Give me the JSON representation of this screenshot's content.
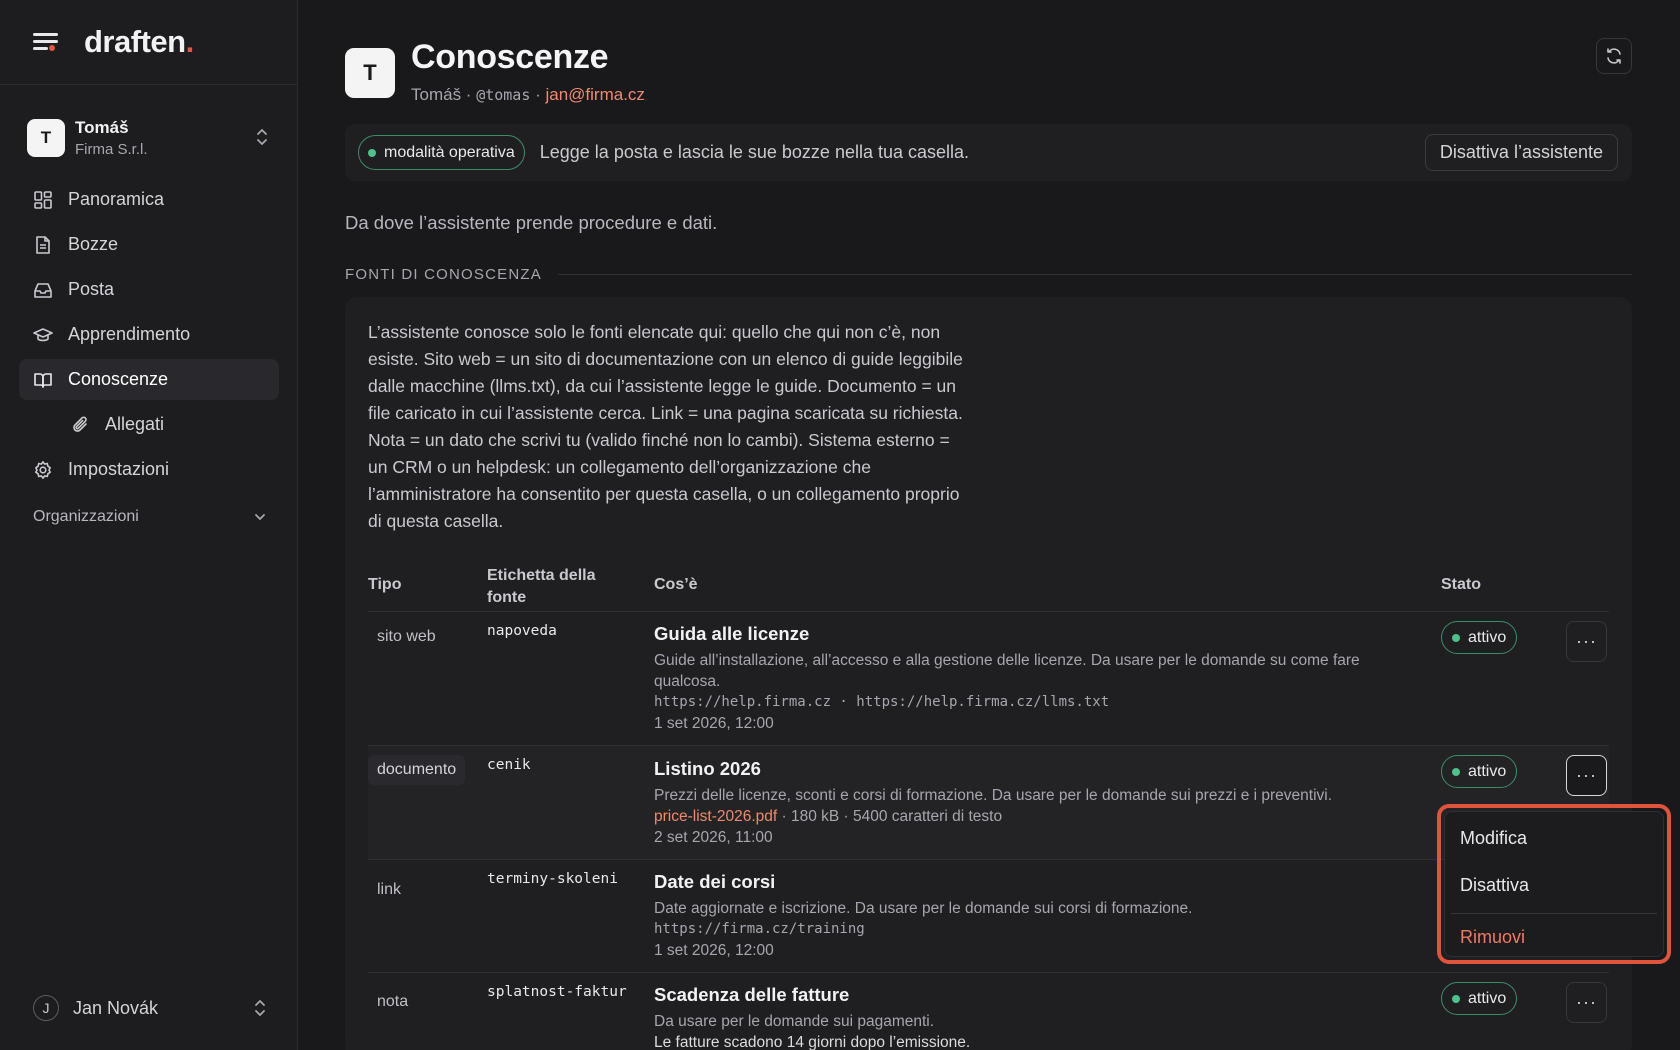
{
  "brand": {
    "name": "draften",
    "dot": "."
  },
  "workspace": {
    "avatar": "T",
    "name": "Tomáš",
    "org": "Firma S.r.l."
  },
  "nav": {
    "items": [
      {
        "label": "Panoramica",
        "icon": "dashboard-icon"
      },
      {
        "label": "Bozze",
        "icon": "document-icon"
      },
      {
        "label": "Posta",
        "icon": "inbox-icon"
      },
      {
        "label": "Apprendimento",
        "icon": "graduation-cap-icon"
      },
      {
        "label": "Conoscenze",
        "icon": "book-icon",
        "active": true
      },
      {
        "label": "Allegati",
        "icon": "paperclip-icon"
      },
      {
        "label": "Impostazioni",
        "icon": "gear-icon"
      }
    ],
    "organizations_label": "Organizzazioni"
  },
  "user": {
    "avatar": "J",
    "name": "Jan Novák"
  },
  "header": {
    "avatar": "T",
    "title": "Conoscenze",
    "name": "Tomáš",
    "separator": " · ",
    "handle": "@tomas",
    "email": "jan@firma.cz"
  },
  "status": {
    "badge": "modalità operativa",
    "text": "Legge la posta e lascia le sue bozze nella tua casella.",
    "deactivate_label": "Disattiva l’assistente",
    "badge_color": "#4cc38a"
  },
  "intro": "Da dove l’assistente prende procedure e dati.",
  "section_label": "FONTI DI CONOSCENZA",
  "card_description": "L’assistente conosce solo le fonti elencate qui: quello che qui non c’è, non esiste. Sito web = un sito di documentazione con un elenco di guide leggibile dalle macchine (llms.txt), da cui l’assistente legge le guide. Documento = un file caricato in cui l’assistente cerca. Link = una pagina scaricata su richiesta. Nota = un dato che scrivi tu (valido finché non lo cambi). Sistema esterno = un CRM o un helpdesk: un collegamento dell’organizzazione che l’amministratore ha consentito per questa casella, o un collegamento proprio di questa casella.",
  "table": {
    "headers": {
      "type": "Tipo",
      "label": "Etichetta della fonte",
      "what": "Cos’è",
      "state": "Stato"
    },
    "rows": [
      {
        "type": "sito web",
        "label": "napoveda",
        "title": "Guida alle licenze",
        "description": "Guide all’installazione, all’accesso e alla gestione delle licenze. Da usare per le domande su come fare qualcosa.",
        "urls": "https://help.firma.cz · https://help.firma.cz/llms.txt",
        "date": "1 set 2026, 12:00",
        "state": "attivo"
      },
      {
        "type": "documento",
        "label": "cenik",
        "title": "Listino 2026",
        "description": "Prezzi delle licenze, sconti e corsi di formazione. Da usare per le domande sui prezzi e i preventivi.",
        "file": "price-list-2026.pdf",
        "file_meta": " · 180 kB · 5400 caratteri di testo",
        "date": "2 set 2026, 11:00",
        "state": "attivo"
      },
      {
        "type": "link",
        "label": "terminy-skoleni",
        "title": "Date dei corsi",
        "description": "Date aggiornate e iscrizione. Da usare per le domande sui corsi di formazione.",
        "urls": "https://firma.cz/training",
        "date": "1 set 2026, 12:00"
      },
      {
        "type": "nota",
        "label": "splatnost-faktur",
        "title": "Scadenza delle fatture",
        "description": "Da usare per le domande sui pagamenti.",
        "note": "Le fatture scadono 14 giorni dopo l’emissione.",
        "state": "attivo"
      }
    ]
  },
  "row_menu": {
    "edit": "Modifica",
    "disable": "Disattiva",
    "remove": "Rimuovi",
    "highlight_color": "#e0533c"
  },
  "more_label": "···"
}
